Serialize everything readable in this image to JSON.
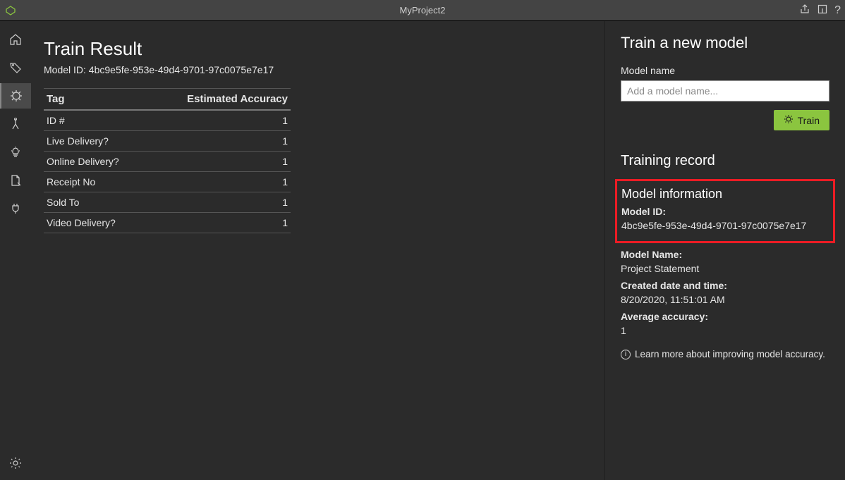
{
  "titlebar": {
    "title": "MyProject2"
  },
  "sidebar_icons": [
    "home",
    "tag",
    "train",
    "compose",
    "bulb",
    "doc",
    "plug",
    "gear"
  ],
  "main": {
    "heading": "Train Result",
    "model_id_line": "Model ID: 4bc9e5fe-953e-49d4-9701-97c0075e7e17",
    "columns": {
      "c1": "Tag",
      "c2": "Estimated Accuracy"
    },
    "rows": [
      {
        "tag": "ID #",
        "acc": "1"
      },
      {
        "tag": "Live Delivery?",
        "acc": "1"
      },
      {
        "tag": "Online Delivery?",
        "acc": "1"
      },
      {
        "tag": "Receipt No",
        "acc": "1"
      },
      {
        "tag": "Sold To",
        "acc": "1"
      },
      {
        "tag": "Video Delivery?",
        "acc": "1"
      }
    ]
  },
  "rp": {
    "heading": "Train a new model",
    "model_name_label": "Model name",
    "model_name_placeholder": "Add a model name...",
    "train_btn": "Train",
    "record_heading": "Training record",
    "info_title": "Model information",
    "model_id_label": "Model ID:",
    "model_id_value": "4bc9e5fe-953e-49d4-9701-97c0075e7e17",
    "model_name_k": "Model Name:",
    "model_name_v": "Project Statement",
    "created_k": "Created date and time:",
    "created_v": "8/20/2020, 11:51:01 AM",
    "acc_k": "Average accuracy:",
    "acc_v": "1",
    "learn_more": "Learn more about improving model accuracy."
  },
  "colors": {
    "accent": "#8bc53f",
    "highlight": "#ec1c24"
  }
}
